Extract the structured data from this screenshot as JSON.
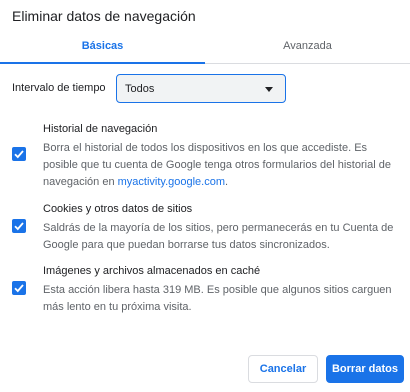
{
  "dialog": {
    "title": "Eliminar datos de navegación"
  },
  "tabs": [
    {
      "label": "Básicas",
      "active": true
    },
    {
      "label": "Avanzada",
      "active": false
    }
  ],
  "time_range": {
    "label": "Intervalo de tiempo",
    "selected": "Todos"
  },
  "options": [
    {
      "title": "Historial de navegación",
      "desc_before": "Borra el historial de todos los dispositivos en los que accediste. Es posible que tu cuenta de Google tenga otros formularios del historial de navegación en ",
      "link": "myactivity.google.com",
      "desc_after": ".",
      "checked": true
    },
    {
      "title": "Cookies y otros datos de sitios",
      "desc": "Saldrás de la mayoría de los sitios, pero permanecerás en tu Cuenta de Google para que puedan borrarse tus datos sincronizados.",
      "checked": true
    },
    {
      "title": "Imágenes y archivos almacenados en caché",
      "desc": "Esta acción libera hasta 319 MB. Es posible que algunos sitios carguen más lento en tu próxima visita.",
      "checked": true
    }
  ],
  "buttons": {
    "cancel": "Cancelar",
    "clear": "Borrar datos"
  },
  "colors": {
    "accent": "#1a73e8",
    "text": "#202124",
    "secondary": "#5f6368"
  },
  "icons": {
    "checkbox": "checkmark-icon",
    "dropdown": "caret-down-icon"
  }
}
